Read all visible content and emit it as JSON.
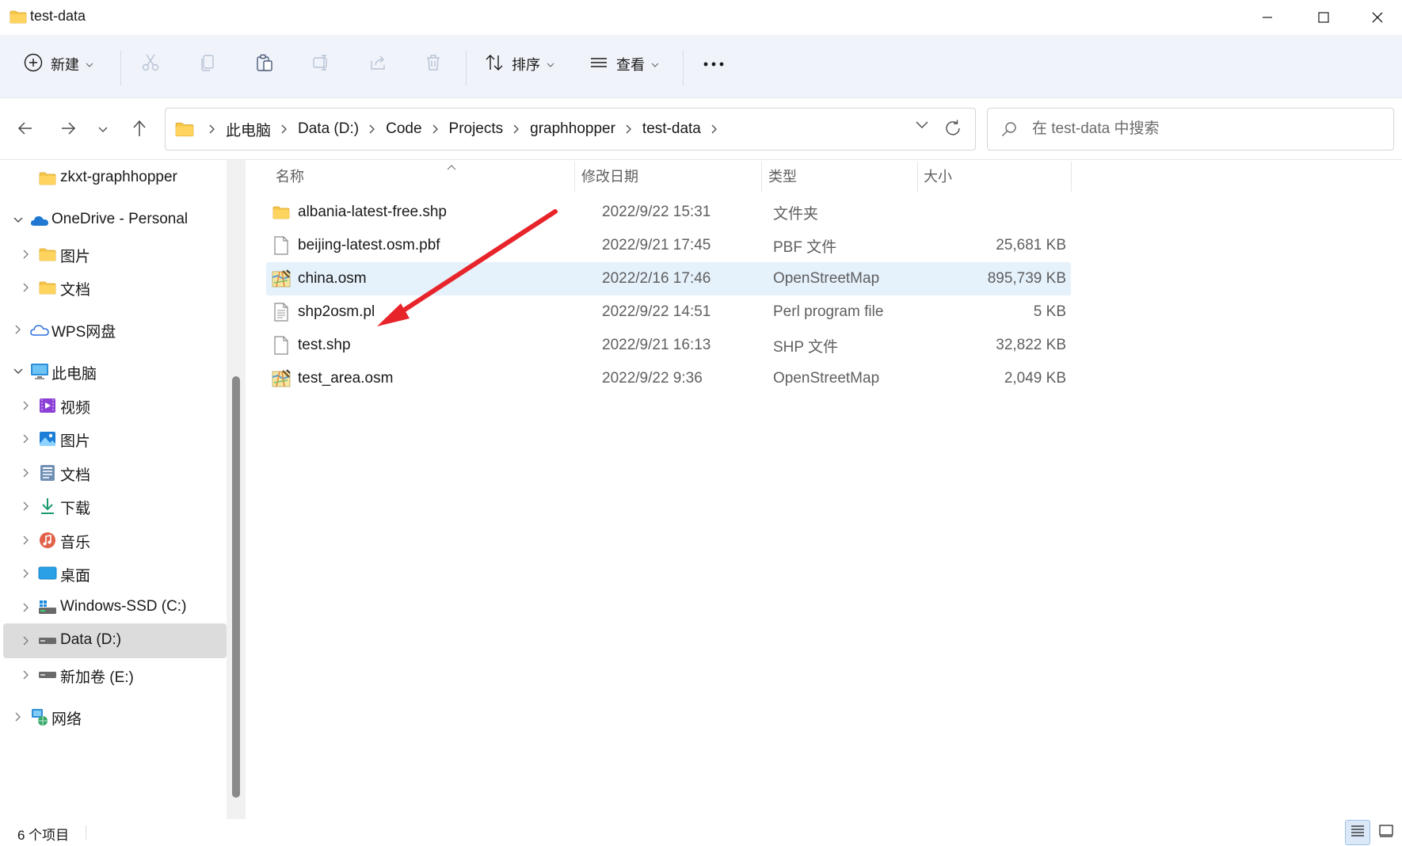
{
  "window": {
    "title": "test-data",
    "icon": "folder-icon"
  },
  "toolbar": {
    "new_label": "新建",
    "sort_label": "排序",
    "view_label": "查看",
    "icons": [
      "cut-icon",
      "copy-icon",
      "paste-icon",
      "rename-icon",
      "share-icon",
      "delete-icon"
    ],
    "more": "more-icon"
  },
  "address": {
    "crumbs": [
      "此电脑",
      "Data (D:)",
      "Code",
      "Projects",
      "graphhopper",
      "test-data"
    ]
  },
  "search": {
    "placeholder": "在 test-data 中搜索"
  },
  "sidebar": {
    "items": [
      {
        "label": "zkxt-graphhopper",
        "icon": "folder-icon",
        "indent": 2,
        "chevron": "none"
      },
      {
        "label": "OneDrive - Personal",
        "icon": "onedrive-icon",
        "indent": 1,
        "chevron": "expanded"
      },
      {
        "label": "图片",
        "icon": "folder-icon",
        "indent": 2,
        "chevron": "collapsed"
      },
      {
        "label": "文档",
        "icon": "folder-icon",
        "indent": 2,
        "chevron": "collapsed"
      },
      {
        "label": "WPS网盘",
        "icon": "wps-cloud-icon",
        "indent": 1,
        "chevron": "collapsed"
      },
      {
        "label": "此电脑",
        "icon": "computer-icon",
        "indent": 1,
        "chevron": "expanded"
      },
      {
        "label": "视频",
        "icon": "videos-icon",
        "indent": 2,
        "chevron": "collapsed"
      },
      {
        "label": "图片",
        "icon": "pictures-icon",
        "indent": 2,
        "chevron": "collapsed"
      },
      {
        "label": "文档",
        "icon": "documents-icon",
        "indent": 2,
        "chevron": "collapsed"
      },
      {
        "label": "下载",
        "icon": "downloads-icon",
        "indent": 2,
        "chevron": "collapsed"
      },
      {
        "label": "音乐",
        "icon": "music-icon",
        "indent": 2,
        "chevron": "collapsed"
      },
      {
        "label": "桌面",
        "icon": "desktop-icon",
        "indent": 2,
        "chevron": "collapsed"
      },
      {
        "label": "Windows-SSD (C:)",
        "icon": "windows-drive-icon",
        "indent": 2,
        "chevron": "collapsed"
      },
      {
        "label": "Data (D:)",
        "icon": "drive-icon",
        "indent": 2,
        "chevron": "collapsed",
        "selected": true
      },
      {
        "label": "新加卷 (E:)",
        "icon": "drive-icon",
        "indent": 2,
        "chevron": "collapsed"
      },
      {
        "label": "网络",
        "icon": "network-icon",
        "indent": 1,
        "chevron": "collapsed"
      }
    ]
  },
  "columns": {
    "name": "名称",
    "date": "修改日期",
    "type": "类型",
    "size": "大小"
  },
  "files": [
    {
      "name": "albania-latest-free.shp",
      "date": "2022/9/22 15:31",
      "type": "文件夹",
      "size": "",
      "icon": "folder-icon"
    },
    {
      "name": "beijing-latest.osm.pbf",
      "date": "2022/9/21 17:45",
      "type": "PBF 文件",
      "size": "25,681 KB",
      "icon": "file-icon"
    },
    {
      "name": "china.osm",
      "date": "2022/2/16 17:46",
      "type": "OpenStreetMap",
      "size": "895,739 KB",
      "icon": "osm-icon",
      "selected": true
    },
    {
      "name": "shp2osm.pl",
      "date": "2022/9/22 14:51",
      "type": "Perl program file",
      "size": "5 KB",
      "icon": "text-file-icon"
    },
    {
      "name": "test.shp",
      "date": "2022/9/21 16:13",
      "type": "SHP 文件",
      "size": "32,822 KB",
      "icon": "file-icon"
    },
    {
      "name": "test_area.osm",
      "date": "2022/9/22 9:36",
      "type": "OpenStreetMap",
      "size": "2,049 KB",
      "icon": "osm-icon"
    }
  ],
  "status": {
    "count_text": "6 个项目"
  },
  "colors": {
    "accent": "#0067c0",
    "selection": "#e5f1fb",
    "annotation_arrow": "#e8242b"
  }
}
